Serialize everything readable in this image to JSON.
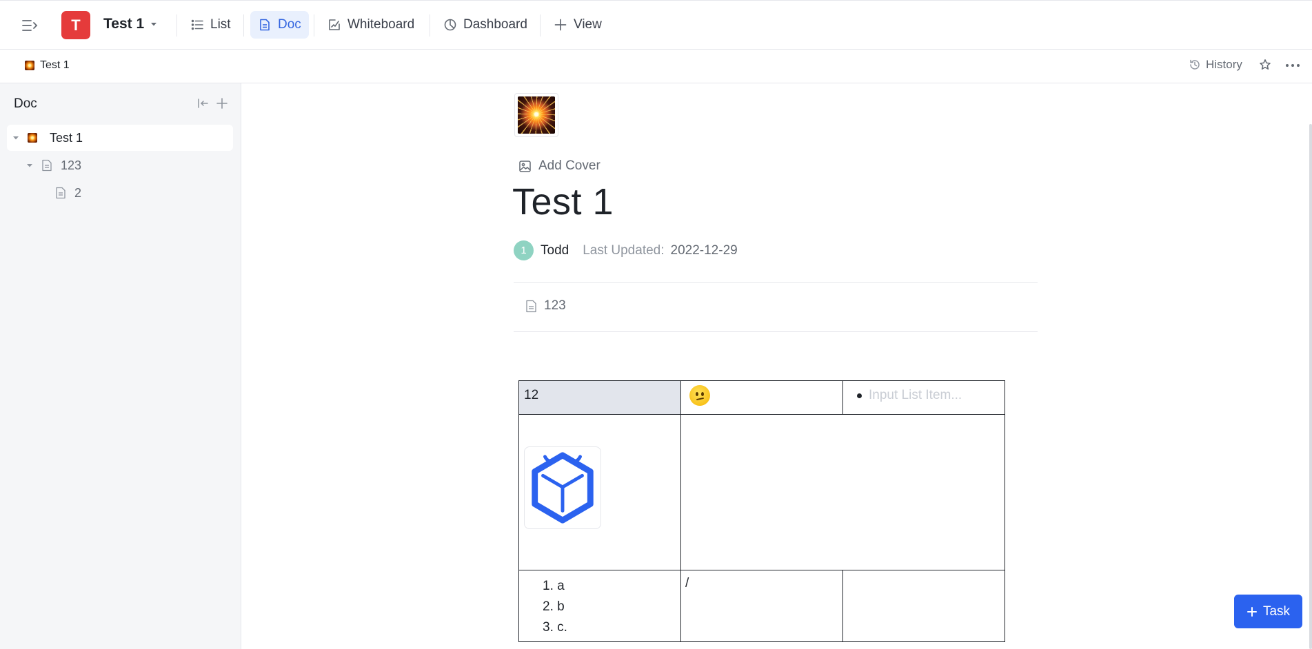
{
  "header": {
    "project_initial": "T",
    "project_title": "Test 1",
    "tabs": [
      {
        "label": "List",
        "icon": "list-icon",
        "active": false
      },
      {
        "label": "Doc",
        "icon": "doc-icon",
        "active": true
      },
      {
        "label": "Whiteboard",
        "icon": "whiteboard-icon",
        "active": false
      },
      {
        "label": "Dashboard",
        "icon": "pie-chart-icon",
        "active": false
      },
      {
        "label": "View",
        "icon": "plus-icon",
        "active": false
      }
    ]
  },
  "breadcrumb": {
    "label": "Test 1",
    "history_label": "History"
  },
  "sidebar": {
    "title": "Doc",
    "tree": [
      {
        "label": "Test 1",
        "level": 0,
        "expanded": true,
        "selected": true,
        "icon": "firework-icon"
      },
      {
        "label": "123",
        "level": 1,
        "expanded": true,
        "selected": false,
        "icon": "page-icon"
      },
      {
        "label": "2",
        "level": 2,
        "expanded": false,
        "selected": false,
        "icon": "page-icon"
      }
    ]
  },
  "doc": {
    "add_cover_label": "Add Cover",
    "title": "Test 1",
    "author_initial": "1",
    "author": "Todd",
    "last_updated_label": "Last Updated:",
    "last_updated": "2022-12-29",
    "subpage": "123",
    "table": {
      "cell_12": "12",
      "emoji": "confused-face",
      "list_placeholder": "Input List Item...",
      "ordered_list": [
        "a",
        "b",
        "c."
      ],
      "slash_cell": "/"
    }
  },
  "task_button_label": "Task",
  "colors": {
    "brand_red": "#e53b3b",
    "accent_blue": "#3466e0",
    "task_blue": "#2b62ef",
    "avatar_teal": "#8fd3c2",
    "selected_cell": "#e2e5ec"
  }
}
